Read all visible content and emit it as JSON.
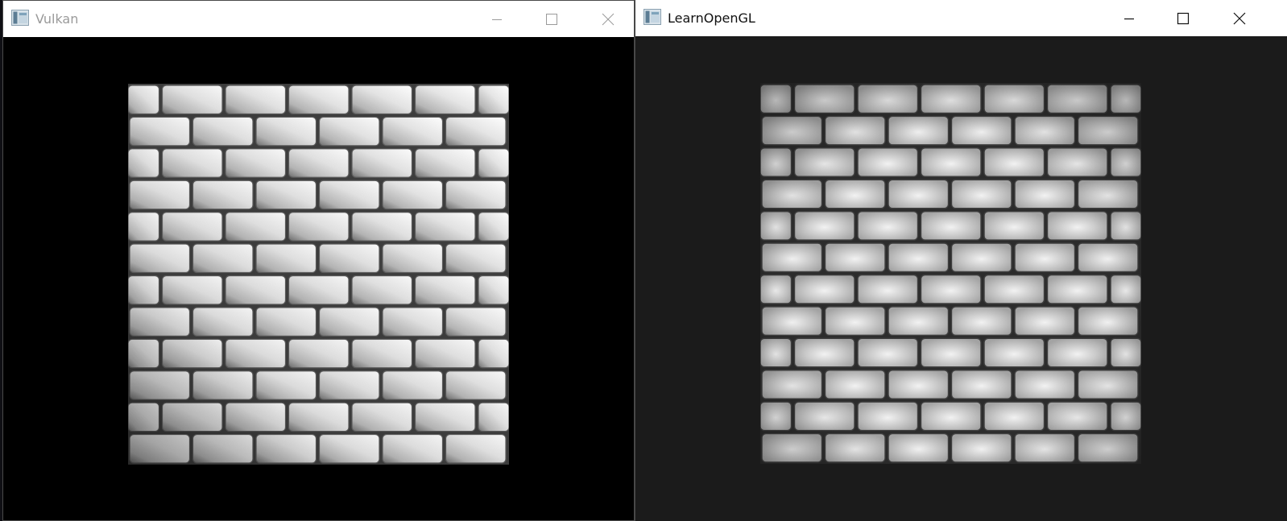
{
  "windows": [
    {
      "title": "Vulkan",
      "active": false,
      "client_background": "#000000",
      "render": "brick wall quad with normal-mapped lighting, brighter toward top-right"
    },
    {
      "title": "LearnOpenGL",
      "active": true,
      "client_background": "#1b1b1b",
      "render": "brick wall quad with normal-mapped lighting, light spot near center"
    }
  ],
  "caption_buttons": [
    "minimize-icon",
    "maximize-icon",
    "close-icon"
  ],
  "icons": {
    "app": "app-window-icon"
  }
}
